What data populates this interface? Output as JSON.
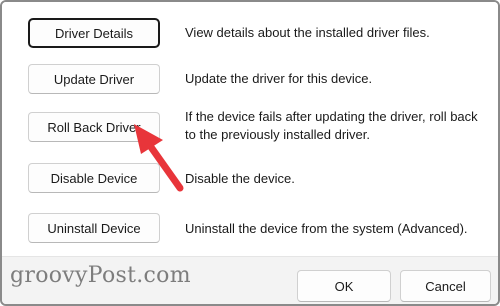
{
  "buttons": [
    {
      "label": "Driver Details",
      "description": "View details about the installed driver files."
    },
    {
      "label": "Update Driver",
      "description": "Update the driver for this device."
    },
    {
      "label": "Roll Back Driver",
      "description": "If the device fails after updating the driver, roll back to the previously installed driver."
    },
    {
      "label": "Disable Device",
      "description": "Disable the device."
    },
    {
      "label": "Uninstall Device",
      "description": "Uninstall the device from the system (Advanced)."
    }
  ],
  "footer": {
    "ok_label": "OK",
    "cancel_label": "Cancel"
  },
  "watermark": "groovyPost.com",
  "colors": {
    "annotation_arrow": "#e8353a",
    "focused_border": "#1a1a1a"
  },
  "icons": {
    "annotation": "red-arrow-icon"
  }
}
